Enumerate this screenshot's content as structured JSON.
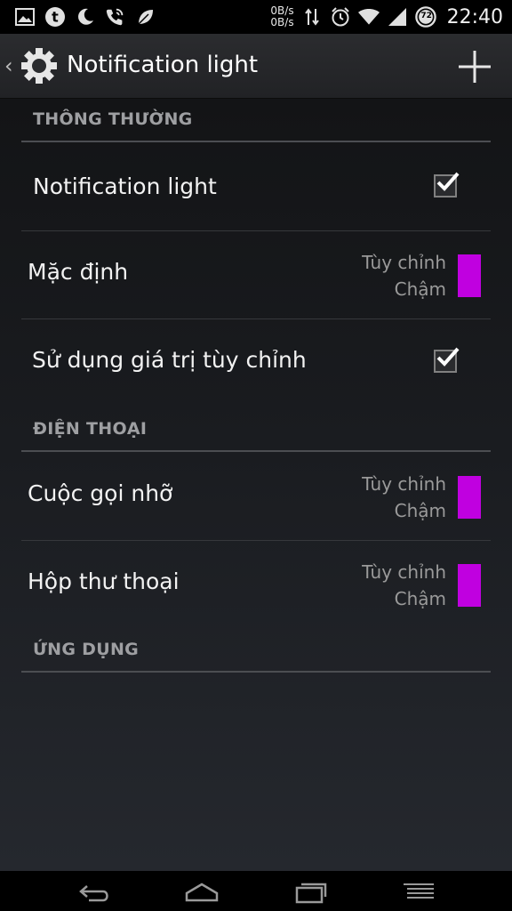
{
  "status_bar": {
    "net_up": "0B/s",
    "net_down": "0B/s",
    "battery_level": "72",
    "time": "22:40",
    "icons": [
      "gallery-icon",
      "tumblr-icon",
      "moon-icon",
      "phone-wifi-icon",
      "leaf-icon",
      "network-activity-icon",
      "alarm-icon",
      "wifi-icon",
      "signal-icon",
      "battery-icon"
    ]
  },
  "action_bar": {
    "title": "Notification light"
  },
  "sections": {
    "general": {
      "header": "THÔNG THƯỜNG"
    },
    "phone": {
      "header": "ĐIỆN THOẠI"
    },
    "apps": {
      "header": "ỨNG DỤNG"
    }
  },
  "prefs": {
    "notification_light": {
      "title": "Notification light",
      "checked": true
    },
    "default": {
      "title": "Mặc định",
      "summary_line1": "Tùy chỉnh",
      "summary_line2": "Chậm",
      "color": "#c000e0"
    },
    "use_custom": {
      "title": "Sử dụng giá trị tùy chỉnh",
      "checked": true
    },
    "missed_call": {
      "title": "Cuộc gọi nhỡ",
      "summary_line1": "Tùy chỉnh",
      "summary_line2": "Chậm",
      "color": "#c000e0"
    },
    "voicemail": {
      "title": "Hộp thư thoại",
      "summary_line1": "Tùy chỉnh",
      "summary_line2": "Chậm",
      "color": "#c000e0"
    }
  },
  "nav_bar": {
    "icons": [
      "back-icon",
      "home-icon",
      "recents-icon",
      "menu-icon"
    ]
  },
  "colors": {
    "accent_swatch": "#c000e0",
    "background_top": "#131416",
    "background_bottom": "#25282e"
  }
}
